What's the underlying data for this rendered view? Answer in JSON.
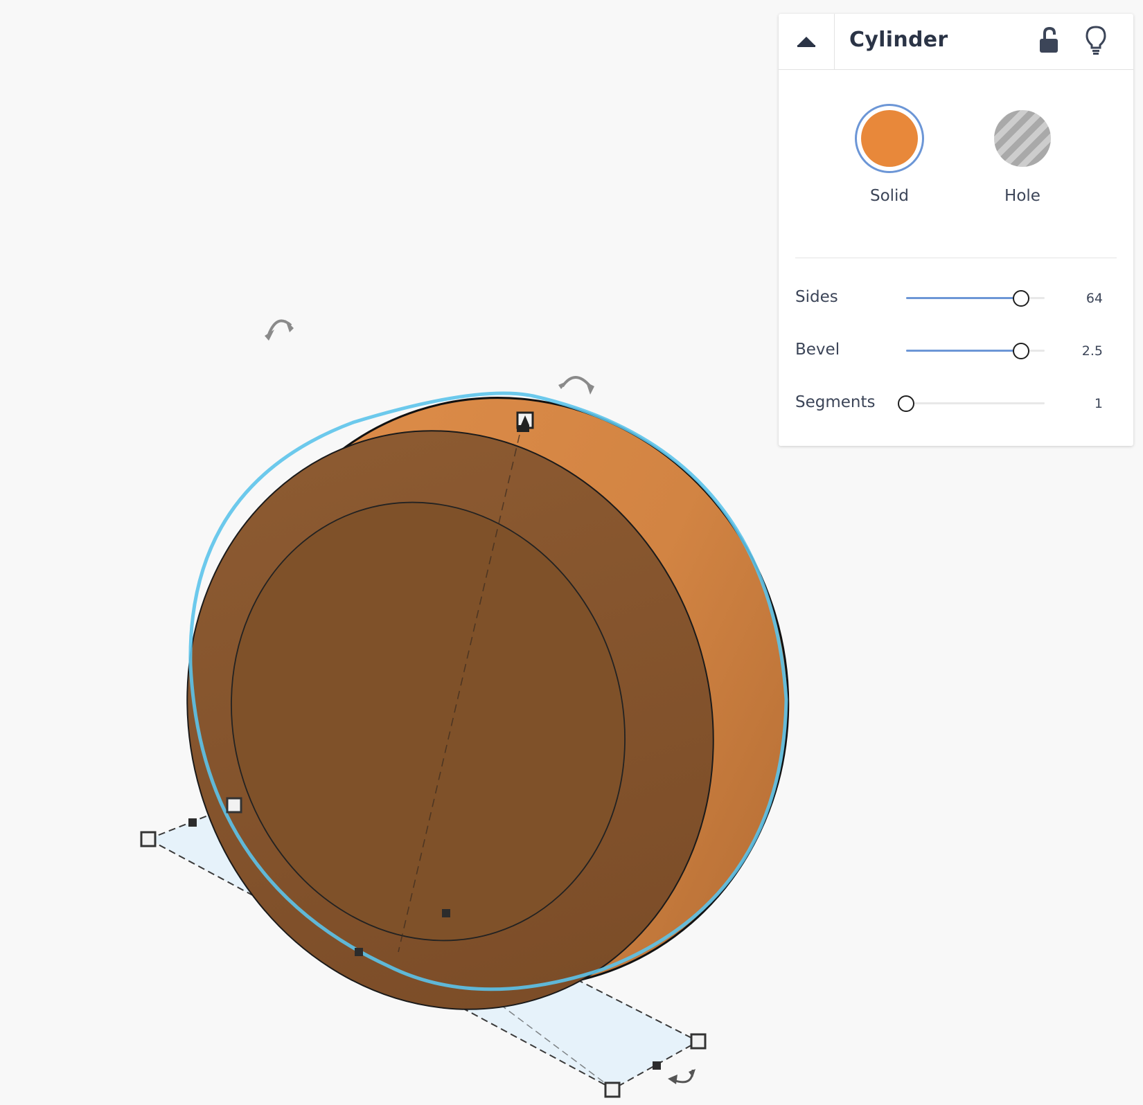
{
  "inspector": {
    "title": "Cylinder",
    "collapse_icon": "caret-up-icon",
    "lock_icon": "lock-open-icon",
    "bulb_icon": "lightbulb-icon",
    "types": {
      "solid": {
        "label": "Solid",
        "color": "#e8883a",
        "selected": true
      },
      "hole": {
        "label": "Hole",
        "selected": false
      }
    },
    "properties": {
      "sides": {
        "label": "Sides",
        "value": "64",
        "fraction": 0.83
      },
      "bevel": {
        "label": "Bevel",
        "value": "2.5",
        "fraction": 0.83
      },
      "segments": {
        "label": "Segments",
        "value": "1",
        "fraction": 0.0
      }
    }
  },
  "colors": {
    "shape_face": "#83532c",
    "shape_side": "#d58a48",
    "selection_outline": "#5cc3ea",
    "workplane_fill": "#e6f2fa",
    "accent": "#6c96d6"
  }
}
